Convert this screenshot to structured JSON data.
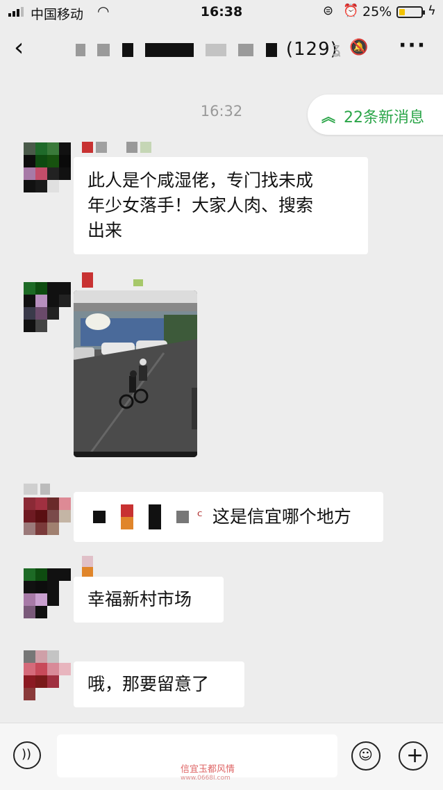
{
  "status_bar": {
    "carrier": "中国移动",
    "time": "16:38",
    "battery": "25%",
    "battery_level": 0.25,
    "signal_icon": "signal-bars-icon",
    "wifi_icon": "wifi-icon",
    "lock_icon": "rotation-lock-icon",
    "alarm_icon": "alarm-icon",
    "charging_icon": "bolt-icon"
  },
  "nav": {
    "back_icon": "chevron-left-icon",
    "title_count": "(129)",
    "more_icon": "more-dots-icon",
    "ear_icon": "earpiece-icon",
    "mute_icon": "mute-bell-icon"
  },
  "chat": {
    "timestamp": "16:32",
    "new_messages": "22条新消息",
    "messages": [
      {
        "type": "text",
        "lines": [
          "此人是个咸湿佬，专门找未成",
          "年少女落手！大家人肉、搜索",
          "出来"
        ]
      },
      {
        "type": "image"
      },
      {
        "type": "text",
        "lines": [
          "这是信宜哪个地方"
        ]
      },
      {
        "type": "text",
        "lines": [
          "幸福新村市场"
        ]
      },
      {
        "type": "text",
        "lines": [
          "哦，那要留意了"
        ]
      }
    ]
  },
  "input_bar": {
    "voice_icon": "voice-icon",
    "emoji_icon": "emoji-icon",
    "plus_icon": "plus-icon"
  },
  "watermark": {
    "text": "信宜玉都风情",
    "url": "www.0668I.com"
  },
  "colors": {
    "accent_green": "#2aa548",
    "background": "#ededed",
    "bubble": "#ffffff"
  }
}
